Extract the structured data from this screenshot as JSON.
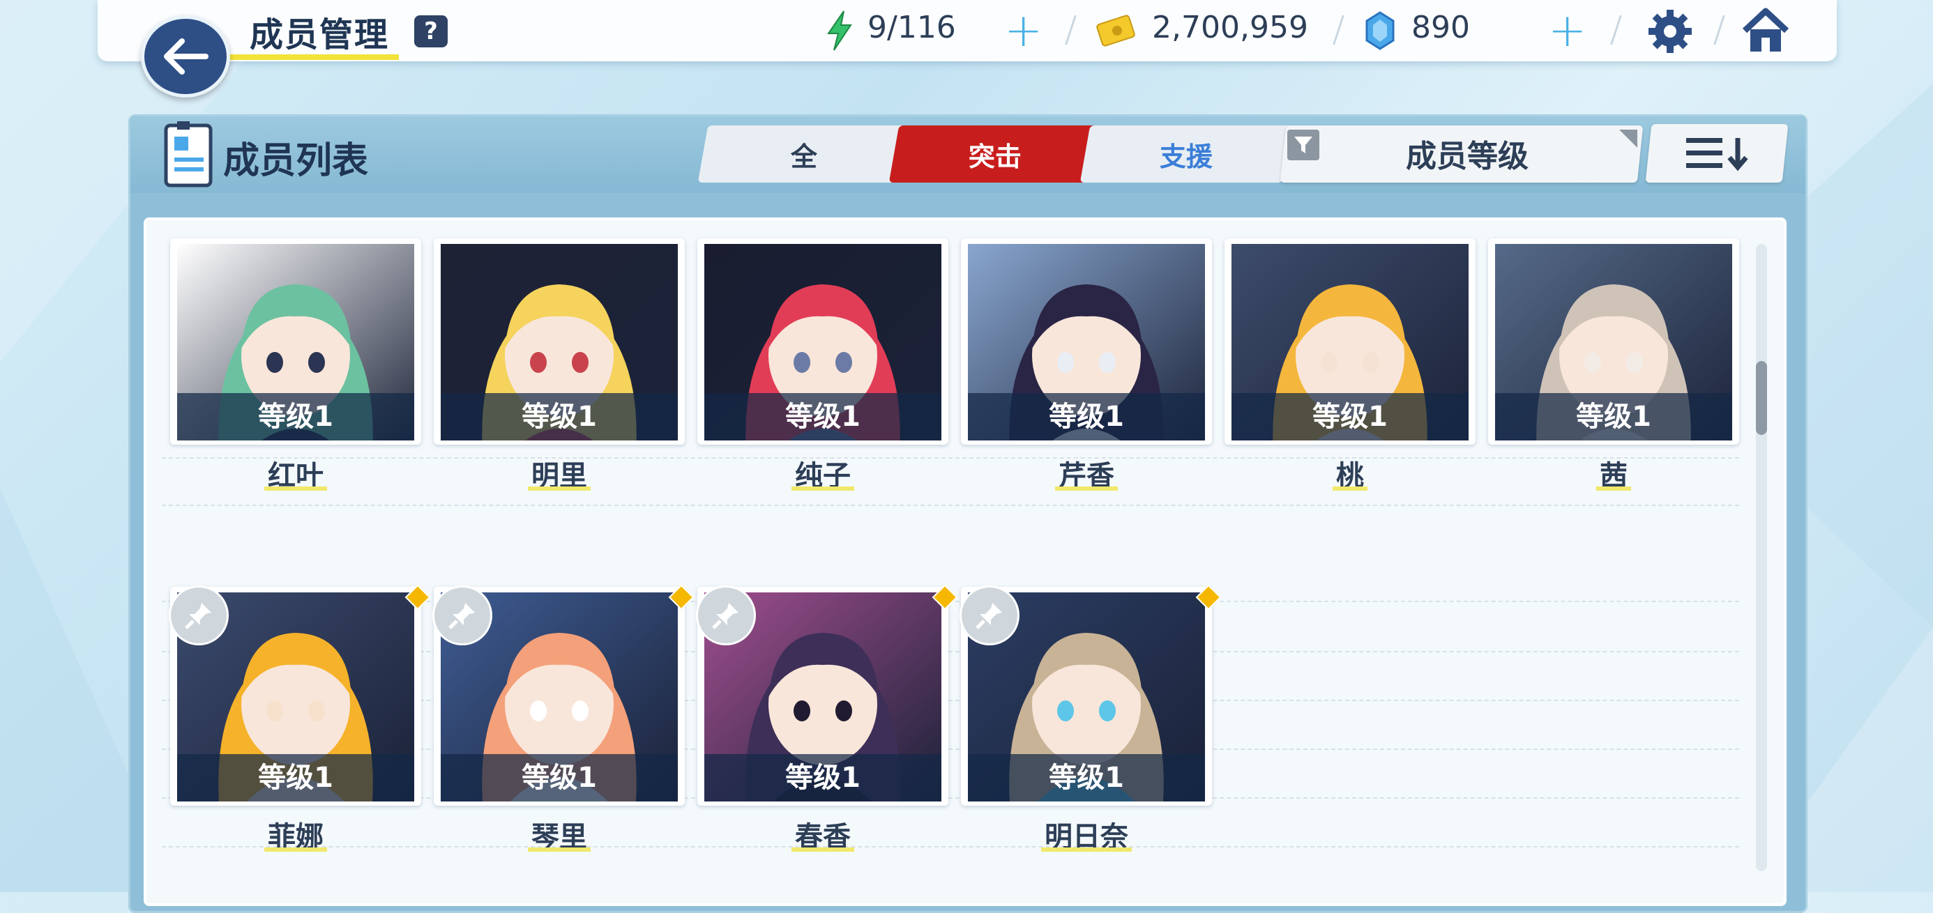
{
  "header": {
    "title": "成员管理",
    "help_label": "?",
    "ap": "9/116",
    "credits": "2,700,959",
    "gems": "890"
  },
  "panel": {
    "list_title": "成员列表",
    "tabs": [
      {
        "label": "全",
        "active": false
      },
      {
        "label": "突击",
        "active": true
      },
      {
        "label": "支援",
        "active": false
      }
    ],
    "filter_label": "成员等级"
  },
  "members": [
    {
      "name": "红叶",
      "level": "等级1",
      "pinned": false,
      "palette": [
        "#6cc1a0",
        "#ffffff",
        "#2b3452"
      ]
    },
    {
      "name": "明里",
      "level": "等级1",
      "pinned": false,
      "palette": [
        "#f5d35c",
        "#1e2235",
        "#c9434d"
      ]
    },
    {
      "name": "纯子",
      "level": "等级1",
      "pinned": false,
      "palette": [
        "#e23d57",
        "#1a1d30",
        "#6b7ba6"
      ]
    },
    {
      "name": "芹香",
      "level": "等级1",
      "pinned": false,
      "palette": [
        "#2a2545",
        "#89a6cf",
        "#e9eef5"
      ]
    },
    {
      "name": "桃",
      "level": "等级1",
      "pinned": false,
      "palette": [
        "#f4b63c",
        "#3d4c6b",
        "#f5e2d4"
      ]
    },
    {
      "name": "茜",
      "level": "等级1",
      "pinned": false,
      "palette": [
        "#cfc3b8",
        "#556a88",
        "#f3ece6"
      ]
    },
    {
      "name": "菲娜",
      "level": "等级1",
      "pinned": true,
      "palette": [
        "#f5b22a",
        "#3b4a6d",
        "#f6e1cd"
      ]
    },
    {
      "name": "琴里",
      "level": "等级1",
      "pinned": true,
      "palette": [
        "#f4a07a",
        "#3e5c93",
        "#ffffff"
      ]
    },
    {
      "name": "春香",
      "level": "等级1",
      "pinned": true,
      "palette": [
        "#3e2f58",
        "#a04e8e",
        "#201b30"
      ]
    },
    {
      "name": "明日奈",
      "level": "等级1",
      "pinned": true,
      "palette": [
        "#c9b396",
        "#2b3d63",
        "#5ec6e8"
      ]
    }
  ],
  "colors": {
    "accent_red": "#c81d1d",
    "accent_blue": "#3b7ed8",
    "navy": "#2e4f86",
    "plus_blue": "#4ab2e6",
    "badge_yellow": "#f5b700"
  },
  "icons": {
    "back": "arrow-left-icon",
    "help": "question-icon",
    "ap": "lightning-icon",
    "credits": "credit-card-icon",
    "gems": "crystal-icon",
    "settings": "gear-icon",
    "home": "home-icon",
    "list": "member-list-icon",
    "filter": "funnel-icon",
    "sort": "sort-descending-icon",
    "pin": "pin-icon"
  }
}
